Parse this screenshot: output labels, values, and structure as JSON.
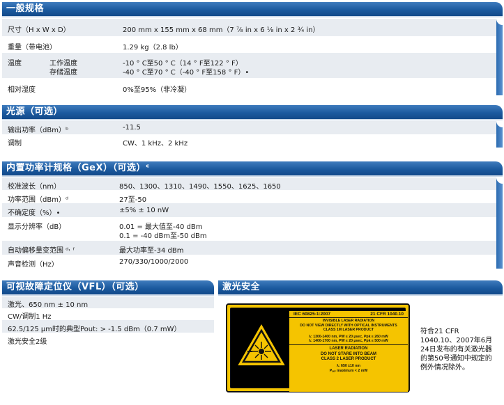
{
  "general": {
    "title": "一般规格",
    "rows": [
      {
        "label": "尺寸（H x W x D）",
        "value": "200 mm x 155 mm x 68 mm（7 ⁷⁄₈ in x 6 ¹⁄₈ in x 2 ¾ in）"
      },
      {
        "label": "重量（带电池）",
        "value": "1.29 kg（2.8 lb）"
      },
      {
        "label": "温度",
        "sub1": "工作温度",
        "sub2": "存储温度",
        "value1": "-10 ° C至50 ° C（14 ° F至122 ° F）",
        "value2": "-40 ° C至70 ° C（-40 ° F至158 ° F）•"
      },
      {
        "label": "相对湿度",
        "value": "0%至95%（非冷凝）"
      }
    ]
  },
  "light_source": {
    "title": "光源（可选）",
    "rows": [
      {
        "label": "输出功率（dBm）ᵇ",
        "value": "-11.5"
      },
      {
        "label": "调制",
        "value": "CW、1 kHz、2 kHz"
      }
    ]
  },
  "power_meter": {
    "title": "内置功率计规格（GeX）（可选）ᶜ",
    "rows": [
      {
        "label": "校准波长（nm）",
        "value": "850、1300、1310、1490、1550、1625、1650"
      },
      {
        "label": "功率范围（dBm）ᵈ",
        "value": "27至-50"
      },
      {
        "label": "不确定度（%）•",
        "value": "±5% ± 10 nW"
      },
      {
        "label": "显示分辨率（dB）",
        "value1": "0.01 = 最大值至-40 dBm",
        "value2": "0.1 = -40 dBm至-50 dBm"
      },
      {
        "label": "自动偏移量变范围 ᵈ˒ ᶠ",
        "value": "最大功率至-34 dBm"
      },
      {
        "label": "声音检测（Hz）",
        "value": "270/330/1000/2000"
      }
    ]
  },
  "vfl": {
    "title": "可视故障定位仪（VFL）（可选）",
    "rows": [
      {
        "text": "激光、650 nm ± 10 nm"
      },
      {
        "text": "CW/调制1 Hz"
      },
      {
        "text": "62.5/125 μm时的典型Pout: > -1.5 dBm（0.7 mW）"
      },
      {
        "text": "激光安全2级"
      }
    ]
  },
  "laser_safety": {
    "title": "激光安全",
    "label": {
      "standard": "IEC 60825-1:2007",
      "cfr": "21 CFR 1040.10",
      "line1": "INVISIBLE LASER RADIATION",
      "line2": "DO NOT VIEW DIRECTLY WITH OPTICAL INSTRUMENTS",
      "line3": "CLASS 1M LASER PRODUCT",
      "line4": "λ: 1300-1400 nm, PW ≤ 20 µsec, Ppk ≤ 260 mW",
      "line5": "λ: 1400-1700 nm, PW ≤ 20 µsec, Ppk ≤ 500 mW",
      "line6": "LASER RADIATION",
      "line7": "DO NOT STARE INTO BEAM",
      "line8": "CLASS 2 LASER PRODUCT",
      "line9": "λ: 650 ±10 nm",
      "line10": "Pₒᵤₜ maximum < 2 mW"
    },
    "note": "符合21 CFR 1040.10、2007年6月24日发布的有关激光器的第50号通知中规定的例外情况除外。"
  }
}
